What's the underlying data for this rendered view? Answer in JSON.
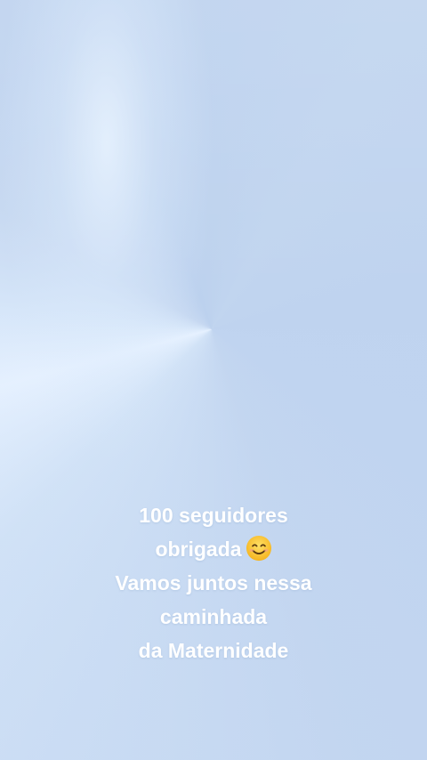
{
  "story": {
    "caption": {
      "line1": "100 seguidores",
      "line2": "obrigada",
      "line3": "Vamos juntos nessa",
      "line4": "caminhada",
      "line5": "da Maternidade"
    },
    "emoji": "smiling-face-with-smiling-eyes",
    "colors": {
      "background": "#c2d6f0",
      "highlight": "#e6f1ff",
      "text": "#ffffff",
      "emoji_face": "#f9c22e"
    }
  }
}
